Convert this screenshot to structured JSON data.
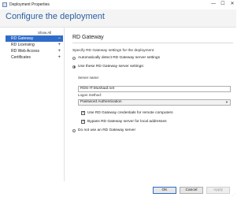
{
  "window": {
    "title": "Deployment Properties",
    "minimize": "—",
    "maximize": "☐",
    "close": "✕"
  },
  "header": {
    "title": "Configure the deployment"
  },
  "nav": {
    "show_all": "Show All",
    "items": [
      {
        "label": "RD Gateway",
        "sign": "−",
        "selected": true
      },
      {
        "label": "RD Licensing",
        "sign": "+",
        "selected": false
      },
      {
        "label": "RD Web Access",
        "sign": "+",
        "selected": false
      },
      {
        "label": "Certificates",
        "sign": "+",
        "selected": false
      }
    ]
  },
  "content": {
    "section_title": "RD Gateway",
    "description": "Specify RD Gateway settings for the deployment",
    "option_auto": "Automatically detect RD Gateway server settings",
    "option_use": "Use these RD Gateway server settings:",
    "server_name_label": "Server name:",
    "server_name_value": "RDS-IT.Mushaaf.net",
    "logon_method_label": "Logon method:",
    "logon_method_value": "Password Authentication",
    "check_credentials": "Use RD Gateway credentials for remote computers",
    "check_bypass": "Bypass RD Gateway server for local addresses",
    "option_none": "Do not use an RD Gateway server",
    "selected_option": "use",
    "credentials_checked": true,
    "bypass_checked": true
  },
  "buttons": {
    "ok": "OK",
    "cancel": "Cancel",
    "apply": "Apply"
  },
  "colors": {
    "accent": "#2f6cc9",
    "header_title": "#2a5fa0"
  }
}
